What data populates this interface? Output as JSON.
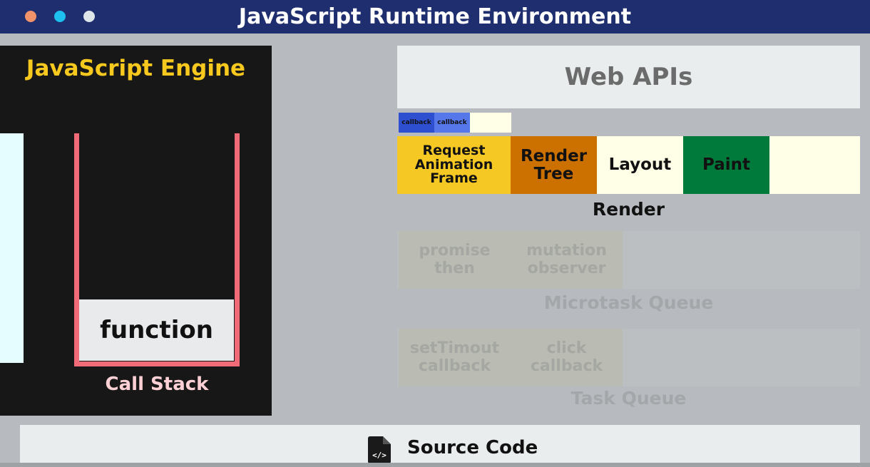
{
  "window": {
    "title": "JavaScript Runtime Environment",
    "dot_colors": [
      "#f0936b",
      "#1ec0f0",
      "#dfe6ea"
    ]
  },
  "engine": {
    "title": "JavaScript Engine",
    "call_stack": {
      "label": "Call Stack",
      "items": [
        "function"
      ]
    }
  },
  "web_apis": {
    "title": "Web APIs"
  },
  "render": {
    "callbacks": [
      "callback",
      "callback"
    ],
    "steps": [
      {
        "label": "Request Animation Frame",
        "color": "#f5c823"
      },
      {
        "label": "Render Tree",
        "color": "#cc7000"
      },
      {
        "label": "Layout",
        "color": "#fffee6"
      },
      {
        "label": "Paint",
        "color": "#007a3a"
      }
    ],
    "label": "Render"
  },
  "microtask_queue": {
    "label": "Microtask Queue",
    "items": [
      "promise then",
      "mutation observer"
    ]
  },
  "task_queue": {
    "label": "Task Queue",
    "items": [
      "setTimout callback",
      "click callback"
    ]
  },
  "source": {
    "label": "Source Code",
    "icon": "code-file-icon"
  }
}
